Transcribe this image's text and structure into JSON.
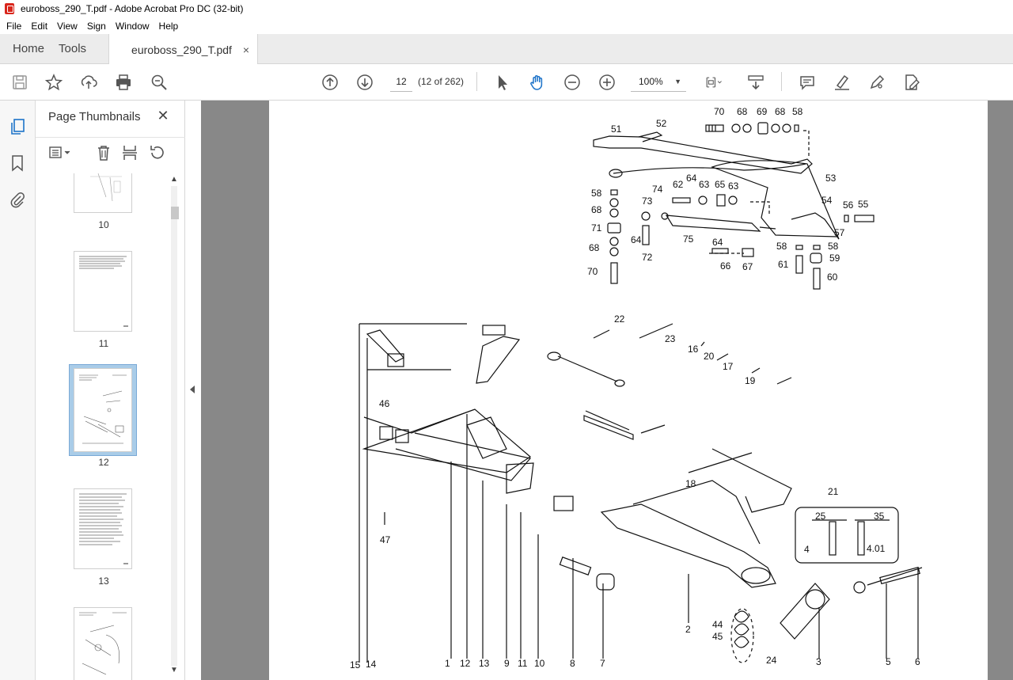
{
  "window": {
    "title": "euroboss_290_T.pdf - Adobe Acrobat Pro DC (32-bit)"
  },
  "menu": [
    "File",
    "Edit",
    "View",
    "Sign",
    "Window",
    "Help"
  ],
  "tabs": {
    "home": "Home",
    "tools": "Tools",
    "document": "euroboss_290_T.pdf",
    "close_glyph": "×"
  },
  "toolbar": {
    "page_number": "12",
    "page_count": "(12 of 262)",
    "zoom": "100%",
    "icons": [
      "save-icon",
      "bookmark-star-icon",
      "upload-icon",
      "print-icon",
      "zoom-search-icon",
      "page-up-icon",
      "page-down-icon",
      "select-cursor-icon",
      "hand-icon",
      "zoom-out-icon",
      "zoom-in-icon",
      "page-fit-icon",
      "scroll-mode-icon",
      "comment-icon",
      "highlight-icon",
      "draw-icon",
      "fill-sign-icon"
    ]
  },
  "thumbnails_panel": {
    "title": "Page Thumbnails",
    "close_glyph": "✕",
    "pages": [
      {
        "label": "10"
      },
      {
        "label": "11"
      },
      {
        "label": "12",
        "selected": true
      },
      {
        "label": "13"
      },
      {
        "label": ""
      }
    ]
  },
  "drawing": {
    "top_labels": [
      "70",
      "68",
      "69",
      "68",
      "58",
      "51",
      "52",
      "53",
      "74",
      "64",
      "62",
      "63",
      "65",
      "63",
      "58",
      "68",
      "71",
      "68",
      "70",
      "73",
      "64",
      "72",
      "75",
      "54",
      "56",
      "55",
      "57",
      "64",
      "66",
      "67",
      "58",
      "58",
      "61",
      "59",
      "60"
    ],
    "bottom_labels": [
      "22",
      "23",
      "16",
      "20",
      "17",
      "19",
      "46",
      "47",
      "18",
      "21",
      "25",
      "35",
      "4",
      "4.01",
      "44",
      "45",
      "2",
      "24",
      "3",
      "5",
      "6",
      "15",
      "14",
      "1",
      "12",
      "13",
      "9",
      "11",
      "10",
      "8",
      "7"
    ]
  }
}
